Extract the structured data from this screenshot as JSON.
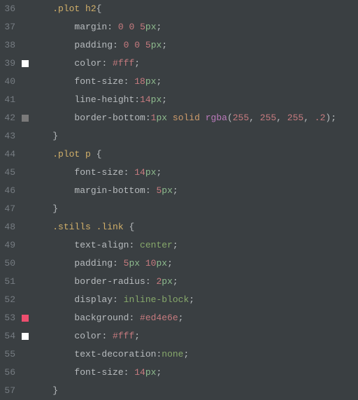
{
  "gutter": {
    "start": 36,
    "end": 57
  },
  "markers": [
    {
      "line": 39,
      "color": "#ffffff"
    },
    {
      "line": 42,
      "color": "#7a7a7a"
    },
    {
      "line": 53,
      "color": "#ed4e6e"
    },
    {
      "line": 54,
      "color": "#ffffff"
    }
  ],
  "code": {
    "indent_selector": "    ",
    "indent_prop": "        ",
    "lines": [
      {
        "n": 36,
        "type": "selector-open",
        "selector": ".plot h2",
        "brace": "{"
      },
      {
        "n": 37,
        "type": "decl",
        "prop": "margin",
        "raw": [
          {
            "t": "num",
            "v": "0"
          },
          {
            "t": "pun",
            "v": " "
          },
          {
            "t": "num",
            "v": "0"
          },
          {
            "t": "pun",
            "v": " "
          },
          {
            "t": "num",
            "v": "5"
          },
          {
            "t": "unit",
            "v": "px"
          }
        ]
      },
      {
        "n": 38,
        "type": "decl",
        "prop": "padding",
        "raw": [
          {
            "t": "num",
            "v": "0"
          },
          {
            "t": "pun",
            "v": " "
          },
          {
            "t": "num",
            "v": "0"
          },
          {
            "t": "pun",
            "v": " "
          },
          {
            "t": "num",
            "v": "5"
          },
          {
            "t": "unit",
            "v": "px"
          }
        ]
      },
      {
        "n": 39,
        "type": "decl",
        "prop": "color",
        "raw": [
          {
            "t": "num",
            "v": "#fff"
          }
        ]
      },
      {
        "n": 40,
        "type": "decl",
        "prop": "font-size",
        "raw": [
          {
            "t": "num",
            "v": "18"
          },
          {
            "t": "unit",
            "v": "px"
          }
        ]
      },
      {
        "n": 41,
        "type": "decl",
        "prop": "line-height",
        "nospace": true,
        "raw": [
          {
            "t": "num",
            "v": "14"
          },
          {
            "t": "unit",
            "v": "px"
          }
        ]
      },
      {
        "n": 42,
        "type": "decl",
        "prop": "border-bottom",
        "nospace": true,
        "raw": [
          {
            "t": "num",
            "v": "1"
          },
          {
            "t": "unit",
            "v": "px"
          },
          {
            "t": "pun",
            "v": " "
          },
          {
            "t": "kw",
            "v": "solid"
          },
          {
            "t": "pun",
            "v": " "
          },
          {
            "t": "func",
            "v": "rgba"
          },
          {
            "t": "pun",
            "v": "("
          },
          {
            "t": "num",
            "v": "255"
          },
          {
            "t": "pun",
            "v": ", "
          },
          {
            "t": "num",
            "v": "255"
          },
          {
            "t": "pun",
            "v": ", "
          },
          {
            "t": "num",
            "v": "255"
          },
          {
            "t": "pun",
            "v": ", "
          },
          {
            "t": "num",
            "v": ".2"
          },
          {
            "t": "pun",
            "v": ")"
          }
        ]
      },
      {
        "n": 43,
        "type": "close",
        "brace": "}"
      },
      {
        "n": 44,
        "type": "selector-open",
        "selector": ".plot p ",
        "brace": "{"
      },
      {
        "n": 45,
        "type": "decl",
        "prop": "font-size",
        "raw": [
          {
            "t": "num",
            "v": "14"
          },
          {
            "t": "unit",
            "v": "px"
          }
        ]
      },
      {
        "n": 46,
        "type": "decl",
        "prop": "margin-bottom",
        "raw": [
          {
            "t": "num",
            "v": "5"
          },
          {
            "t": "unit",
            "v": "px"
          }
        ]
      },
      {
        "n": 47,
        "type": "close",
        "brace": "}"
      },
      {
        "n": 48,
        "type": "selector-open",
        "selector": ".stills .link ",
        "brace": "{"
      },
      {
        "n": 49,
        "type": "decl",
        "prop": "text-align",
        "raw": [
          {
            "t": "val",
            "v": "center"
          }
        ]
      },
      {
        "n": 50,
        "type": "decl",
        "prop": "padding",
        "raw": [
          {
            "t": "num",
            "v": "5"
          },
          {
            "t": "unit",
            "v": "px"
          },
          {
            "t": "pun",
            "v": " "
          },
          {
            "t": "num",
            "v": "10"
          },
          {
            "t": "unit",
            "v": "px"
          }
        ]
      },
      {
        "n": 51,
        "type": "decl",
        "prop": "border-radius",
        "raw": [
          {
            "t": "num",
            "v": "2"
          },
          {
            "t": "unit",
            "v": "px"
          }
        ]
      },
      {
        "n": 52,
        "type": "decl",
        "prop": "display",
        "raw": [
          {
            "t": "val",
            "v": "inline-block"
          }
        ]
      },
      {
        "n": 53,
        "type": "decl",
        "prop": "background",
        "raw": [
          {
            "t": "num",
            "v": "#ed4e6e"
          }
        ]
      },
      {
        "n": 54,
        "type": "decl",
        "prop": "color",
        "raw": [
          {
            "t": "num",
            "v": "#fff"
          }
        ]
      },
      {
        "n": 55,
        "type": "decl",
        "prop": "text-decoration",
        "nospace": true,
        "raw": [
          {
            "t": "val",
            "v": "none"
          }
        ]
      },
      {
        "n": 56,
        "type": "decl",
        "prop": "font-size",
        "raw": [
          {
            "t": "num",
            "v": "14"
          },
          {
            "t": "unit",
            "v": "px"
          }
        ]
      },
      {
        "n": 57,
        "type": "close",
        "brace": "}"
      }
    ]
  }
}
